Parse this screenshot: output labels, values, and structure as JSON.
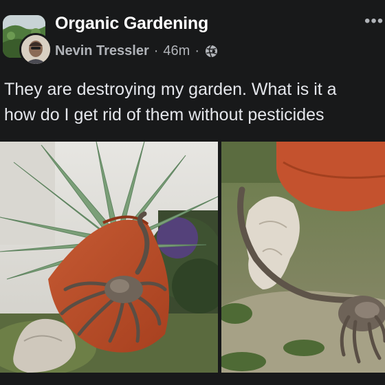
{
  "post": {
    "group_name": "Organic Gardening",
    "author": "Nevin Tressler",
    "separator": "·",
    "time": "46m",
    "privacy_icon": "globe-icon",
    "more_icon": "more-options-icon",
    "more_glyph": "•••",
    "text_line1": "They are destroying my garden. What is it a",
    "text_line2": "how do I get rid of them without pesticides"
  },
  "photos": [
    {
      "subject": "alien-facehugger-on-terracotta-pot"
    },
    {
      "subject": "alien-facehugger-on-garden-ground"
    }
  ],
  "colors": {
    "background": "#18191a",
    "primary_text": "#e4e6eb",
    "secondary_text": "#b0b3b8",
    "group_name": "#ffffff"
  }
}
